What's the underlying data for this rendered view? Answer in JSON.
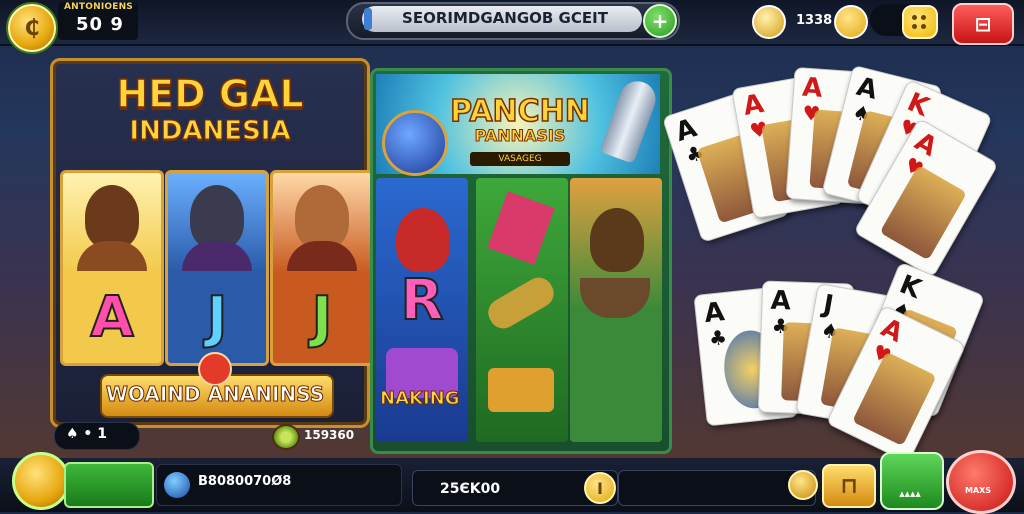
{
  "top_bar": {
    "player_label": "ANTONIOENS",
    "player_score": "50 9",
    "title": "SEORIMDGANGOB GCEIT",
    "plus_label": "+",
    "gold_amount": "1338",
    "exit_label": "⊟"
  },
  "left_panel": {
    "title_line1": "HED GAL",
    "title_line2": "INDANESIA",
    "reel_letters": [
      "A",
      "J",
      "J"
    ],
    "banner_text": "WOAIND ANANINSS",
    "spade_count": "♠ • 1",
    "kiwi_value": "159360"
  },
  "mid_panel": {
    "title_line1": "PANCHN",
    "title_line2": "PANNASIS",
    "subtitle": "VASAGEG",
    "reel_letter": "R",
    "banner_text": "NAKING"
  },
  "cards": [
    {
      "rank": "A",
      "suit": "♣",
      "color": "#111111"
    },
    {
      "rank": "A",
      "suit": "♥",
      "color": "#d01818"
    },
    {
      "rank": "A",
      "suit": "♥",
      "color": "#d01818"
    },
    {
      "rank": "A",
      "suit": "♠",
      "color": "#111111"
    },
    {
      "rank": "K",
      "suit": "♥",
      "color": "#d01818"
    },
    {
      "rank": "A",
      "suit": "♥",
      "color": "#d01818"
    },
    {
      "rank": "A",
      "suit": "♣",
      "color": "#111111"
    },
    {
      "rank": "A",
      "suit": "♣",
      "color": "#111111"
    },
    {
      "rank": "J",
      "suit": "♠",
      "color": "#111111"
    },
    {
      "rank": "K",
      "suit": "♠",
      "color": "#111111"
    },
    {
      "rank": "A",
      "suit": "♥",
      "color": "#d01818"
    }
  ],
  "bottom_bar": {
    "info_text": "B8080070Ø8",
    "bet_value": "25ЄK00",
    "bet_coin_label": "I",
    "bonus_label": "⊓",
    "spin_label": "▲▲▲▲",
    "max_label": "MAXS"
  },
  "colors": {
    "accent_gold": "#ffd43b",
    "button_green": "#2f9a23",
    "button_red": "#c81414"
  }
}
